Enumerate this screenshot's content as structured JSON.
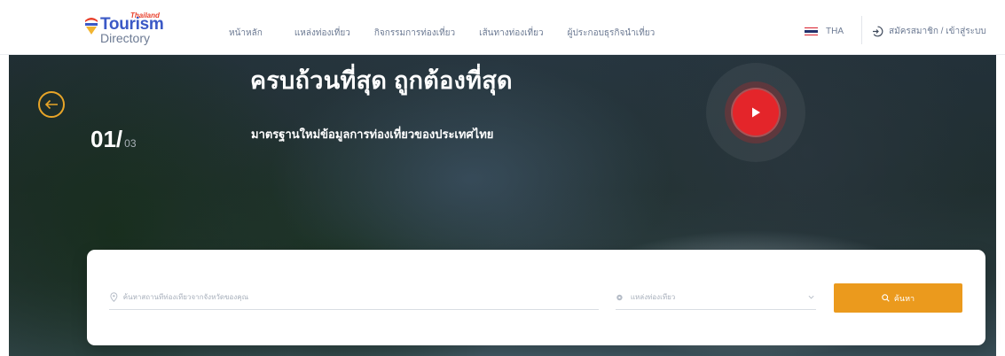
{
  "brand": {
    "top": "Thailand",
    "name": "Tourism",
    "sub": "Directory",
    "colors": {
      "primary": "#3b59c6",
      "accent": "#e83e2a",
      "yellow": "#f2b531"
    }
  },
  "nav": [
    {
      "label": "หน้าหลัก"
    },
    {
      "label": "แหล่งท่องเที่ยว"
    },
    {
      "label": "กิจกรรมการท่องเที่ยว"
    },
    {
      "label": "เส้นทางท่องเที่ยว"
    },
    {
      "label": "ผู้ประกอบธุรกิจนำเที่ยว"
    }
  ],
  "language": {
    "code": "THA",
    "flag_icon": "thai-flag-icon"
  },
  "account": {
    "label": "สมัครสมาชิก / เข้าสู่ระบบ",
    "icon": "login-icon"
  },
  "hero": {
    "headline": "ครบถ้วนที่สุด ถูกต้องที่สุด",
    "subline": "มาตรฐานใหม่ข้อมูลการท่องเที่ยวของประเทศไทย",
    "slide_current": "01/",
    "slide_total": "03",
    "prev_icon": "arrow-left-icon",
    "play_icon": "play-icon",
    "play_color": "#e4252a",
    "prev_color": "#e8a528"
  },
  "search": {
    "location_placeholder": "ค้นหาสถานที่ท่องเที่ยวจากจังหวัดของคุณ",
    "category_placeholder": "แหล่งท่องเที่ยว",
    "button_label": "ค้นหา",
    "button_color": "#eb9a1d"
  }
}
